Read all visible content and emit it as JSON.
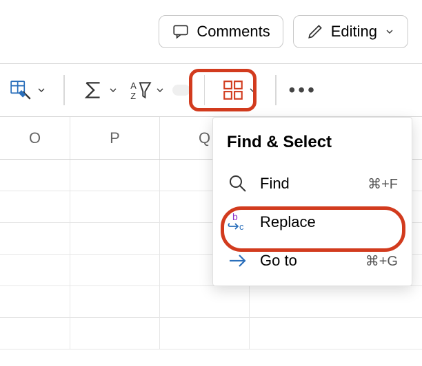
{
  "topbar": {
    "comments_label": "Comments",
    "editing_label": "Editing"
  },
  "ribbon": {
    "clean_label": "",
    "sum_label": "",
    "sort_label": "",
    "search_label": "",
    "view_label": ""
  },
  "columns": [
    "O",
    "P",
    "Q"
  ],
  "menu": {
    "title": "Find & Select",
    "find_label": "Find",
    "find_shortcut": "⌘+F",
    "replace_label": "Replace",
    "goto_label": "Go to",
    "goto_shortcut": "⌘+G"
  }
}
